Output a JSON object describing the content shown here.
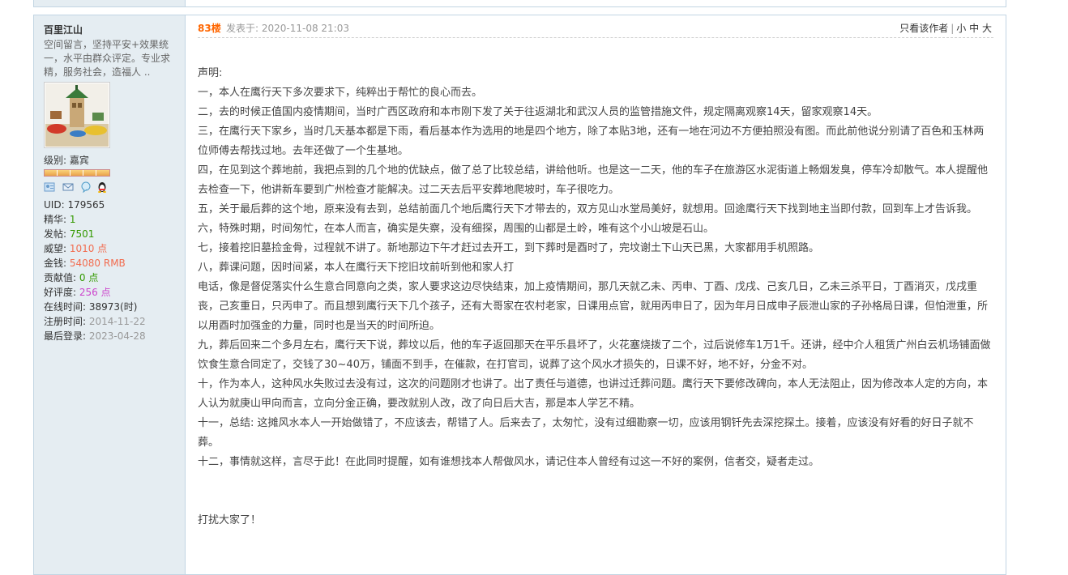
{
  "user": {
    "name": "百里江山",
    "signature": "空间留言，坚持平安+效果统一，水平由群众评定。专业求精，服务社会，造福人 ..",
    "level_label": "级别:",
    "level_value": "嘉宾",
    "stats": [
      {
        "key": "UID:",
        "value": "179565",
        "color": "plain"
      },
      {
        "key": "精华:",
        "value": "1",
        "color": "green"
      },
      {
        "key": "发帖:",
        "value": "7501",
        "color": "green"
      },
      {
        "key": "威望:",
        "value": "1010 点",
        "color": "red"
      },
      {
        "key": "金钱:",
        "value": "54080 RMB",
        "color": "red"
      },
      {
        "key": "贡献值:",
        "value": "0 点",
        "color": "green"
      },
      {
        "key": "好评度:",
        "value": "256 点",
        "color": "purple"
      },
      {
        "key": "在线时间:",
        "value": "38973(时)",
        "color": "plain"
      },
      {
        "key": "注册时间:",
        "value": "2014-11-22",
        "color": "grey"
      },
      {
        "key": "最后登录:",
        "value": "2023-04-28",
        "color": "grey"
      }
    ],
    "icons": [
      "profile-card-icon",
      "message-icon",
      "chat-bubble-icon",
      "qq-penguin-icon"
    ]
  },
  "post": {
    "floor": "83楼",
    "posted": "发表于: 2020-11-08 21:03",
    "only_author": "只看该作者",
    "size_small": "小",
    "size_medium": "中",
    "size_large": "大",
    "separator": "|",
    "paragraphs": [
      "声明:",
      "一，本人在鹰行天下多次要求下，纯粹出于帮忙的良心而去。",
      "二，去的时候正值国内疫情期间，当时广西区政府和本市刚下发了关于往返湖北和武汉人员的监管措施文件，规定隔离观察14天，留家观察14天。",
      "三，在鹰行天下家乡，当时几天基本都是下雨，看后基本作为选用的地是四个地方，除了本贴3地，还有一地在河边不方便拍照没有图。而此前他说分别请了百色和玉林两位师傅去帮找过地。去年还做了一个生基地。",
      "四，在见到这个葬地前，我把点到的几个地的优缺点，做了总了比较总结，讲给他听。也是这一二天，他的车子在旅游区水泥街道上畅烟发臭，停车冷却散气。本人提醒他去检查一下，他讲新车要到广州检查才能解决。过二天去后平安葬地爬坡时，车子很吃力。",
      "五，关于最后葬的这个地，原来没有去到，总结前面几个地后鹰行天下才带去的，双方见山水堂局美好，就想用。回途鹰行天下找到地主当即付款，回到车上才告诉我。",
      "六，特殊时期，时间匆忙，在本人而言，确实是失察，没有细探，周围的山都是土岭，唯有这个小山坡是石山。",
      "七，接着挖旧墓捡金骨，过程就不讲了。新地那边下午才赶过去开工，到下葬时是酉时了，完坟谢土下山天已黑，大家都用手机照路。",
      "八，葬课问题，因时间紧，本人在鹰行天下挖旧坟前听到他和家人打",
      "电话，像是督促落实什么生意合同意向之类，家人要求这边尽快结束，加上疫情期间，那几天就乙未、丙申、丁酉、戊戌、己亥几日，乙未三杀平日，丁酉消灭，戊戌重丧，己亥重日，只丙申了。而且想到鹰行天下几个孩子，还有大哥家在农村老家，日课用点官，就用丙申日了，因为年月日成申子辰泄山家的子孙格局日课，但怕泄重，所以用酉时加强金的力量，同时也是当天的时间所迫。",
      "九，葬后回来二个多月左右，鹰行天下说，葬坟以后，他的车子返回那天在平乐县坏了，火花塞烧拨了二个，过后说修车1万1千。还讲，经中介人租赁广州白云机场铺面做饮食生意合同定了，交钱了30~40万，铺面不到手，在催款，在打官司，说葬了这个风水才损失的，日课不好，地不好，分金不对。",
      "十，作为本人，这种风水失败过去没有过，这次的问题刚才也讲了。出了责任与道德，也讲过迁葬问题。鹰行天下要修改碑向，本人无法阻止，因为修改本人定的方向，本人认为就庚山甲向而言，立向分金正确，要改就别人改，改了向日后大吉，那是本人学艺不精。",
      "十一，总结: 这摊风水本人一开始做错了，不应该去，帮错了人。后来去了，太匆忙，没有过细勘察一切，应该用钢钎先去深挖探土。接着，应该没有好看的好日子就不葬。",
      "十二，事情就这样，言尽于此！在此同时提醒，如有谁想找本人帮做风水，请记住本人曾经有过这一不好的案例，信者交，疑者走过。"
    ],
    "closing": "打扰大家了！"
  }
}
